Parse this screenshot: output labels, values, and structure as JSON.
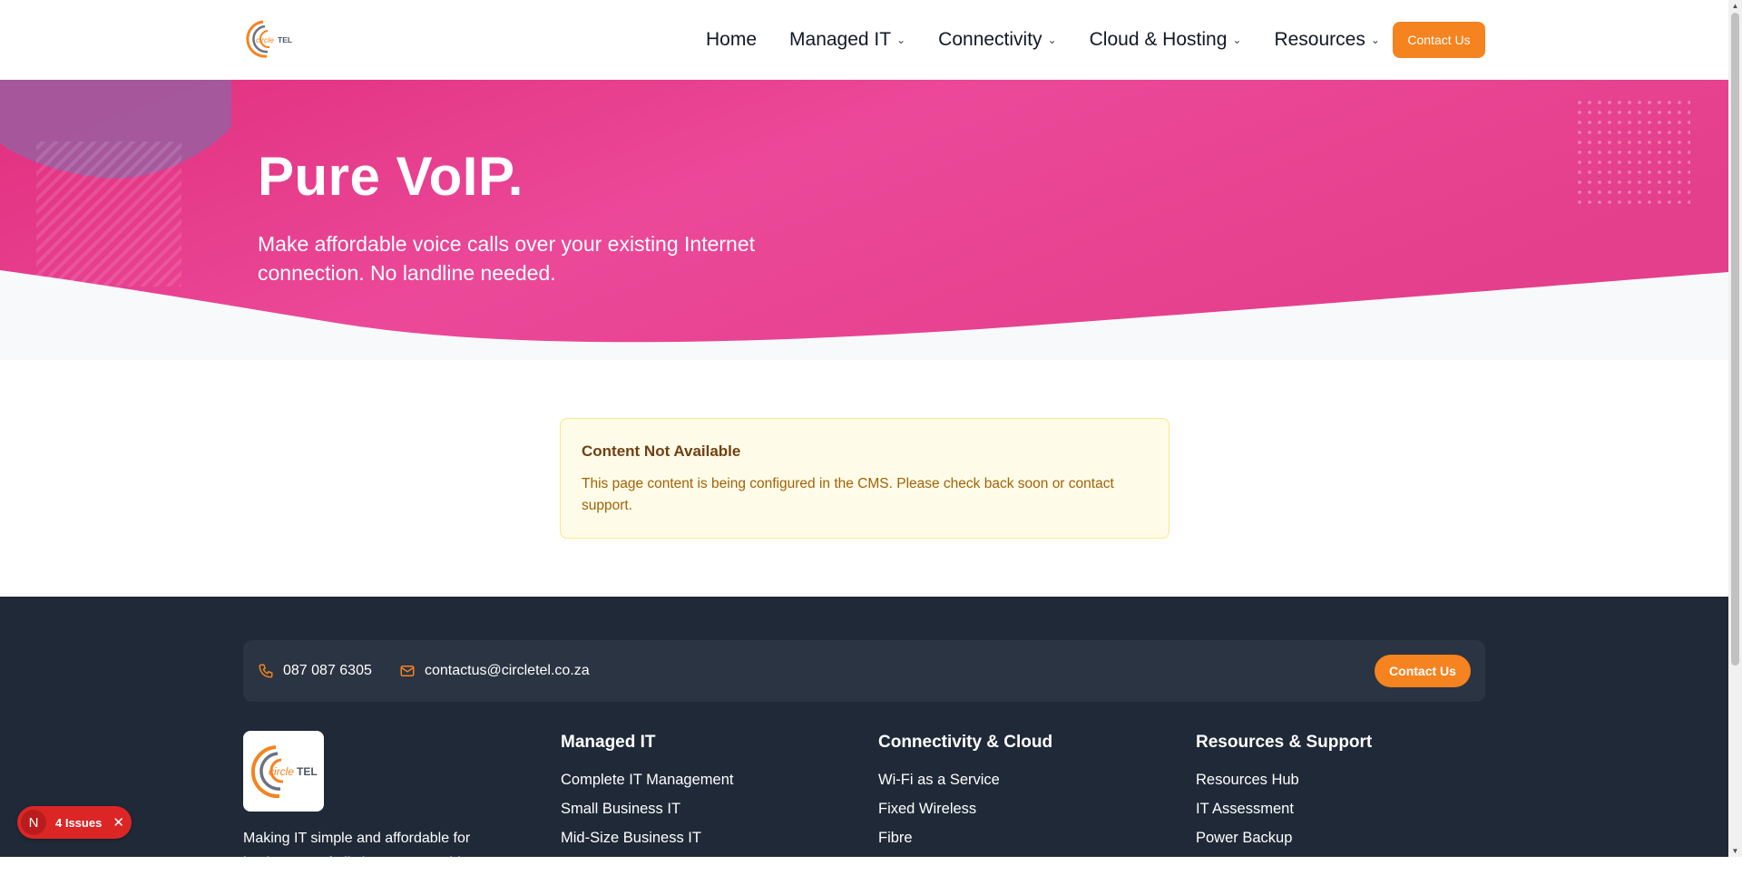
{
  "header": {
    "logo_text": "circleTEL",
    "nav": [
      {
        "label": "Home",
        "has_menu": false
      },
      {
        "label": "Managed IT",
        "has_menu": true
      },
      {
        "label": "Connectivity",
        "has_menu": true
      },
      {
        "label": "Cloud & Hosting",
        "has_menu": true
      },
      {
        "label": "Resources",
        "has_menu": true
      }
    ],
    "contact_button": "Contact Us"
  },
  "hero": {
    "title": "Pure VoIP.",
    "subtitle": "Make affordable voice calls over your existing Internet connection. No landline needed."
  },
  "notice": {
    "title": "Content Not Available",
    "message": "This page content is being configured in the CMS. Please check back soon or contact support."
  },
  "footer": {
    "phone": "087 087 6305",
    "email": "contactus@circletel.co.za",
    "contact_button": "Contact Us",
    "tagline": "Making IT simple and affordable for businesses of all sizes. We provide expert IT",
    "columns": [
      {
        "heading": "Managed IT",
        "links": [
          "Complete IT Management",
          "Small Business IT",
          "Mid-Size Business IT"
        ]
      },
      {
        "heading": "Connectivity & Cloud",
        "links": [
          "Wi-Fi as a Service",
          "Fixed Wireless",
          "Fibre"
        ]
      },
      {
        "heading": "Resources & Support",
        "links": [
          "Resources Hub",
          "IT Assessment",
          "Power Backup"
        ]
      }
    ]
  },
  "dev_overlay": {
    "badge_letter": "N",
    "issues_label": "4 Issues"
  },
  "colors": {
    "brand_orange": "#f5831f",
    "hero_pink": "#e8408f",
    "footer_dark": "#1f2937",
    "notice_bg": "#fefce8"
  },
  "icons": [
    "chevron-down-icon",
    "phone-icon",
    "mail-icon",
    "close-icon"
  ]
}
